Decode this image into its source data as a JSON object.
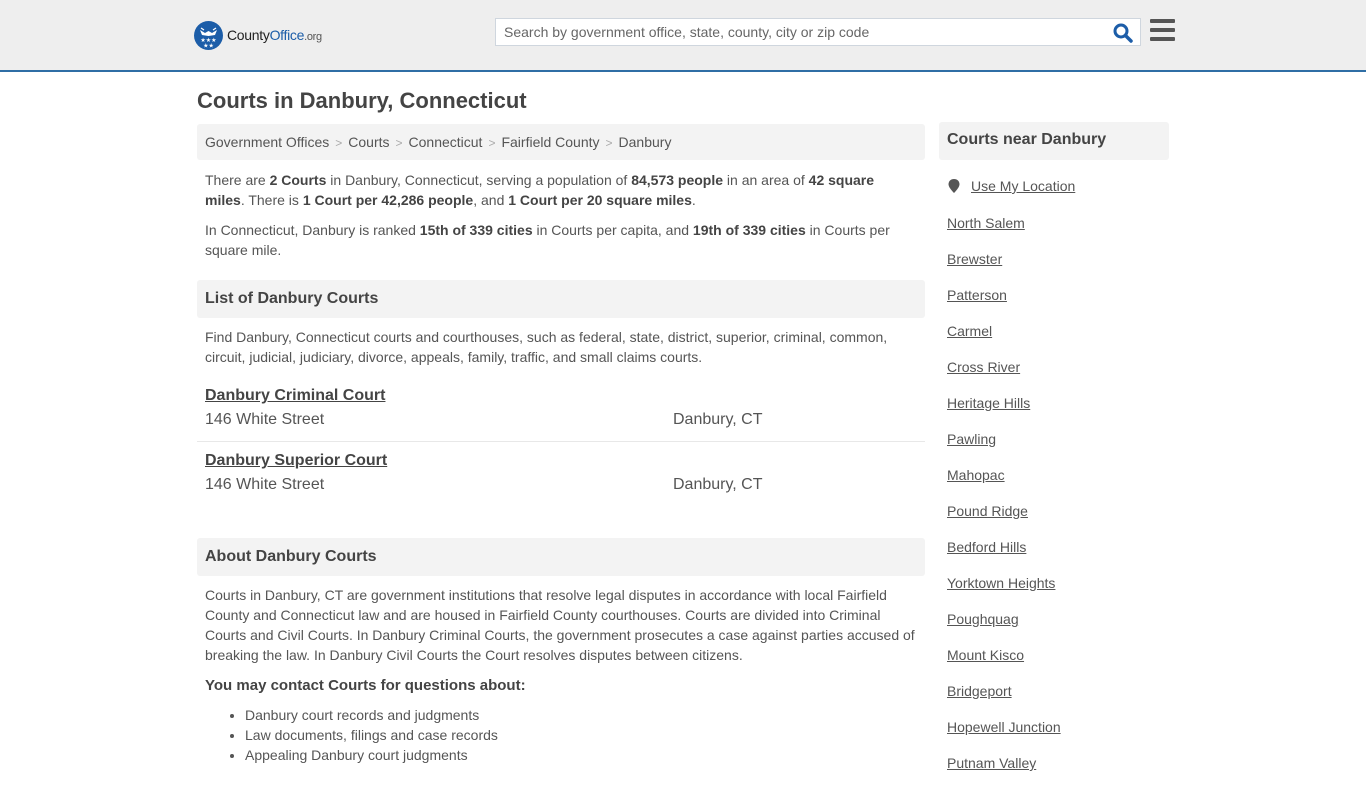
{
  "header": {
    "logo": {
      "name": "County",
      "name_accent": "Office",
      "tld": ".org"
    },
    "search": {
      "placeholder": "Search by government office, state, county, city or zip code",
      "value": ""
    },
    "colors": {
      "accent": "#1c5da8",
      "border": "#2f6ea5",
      "header_bg": "#eeeeee"
    }
  },
  "page": {
    "title": "Courts in Danbury, Connecticut"
  },
  "breadcrumb": [
    "Government Offices",
    "Courts",
    "Connecticut",
    "Fairfield County",
    "Danbury"
  ],
  "summary": {
    "p1": {
      "t1": "There are ",
      "b1": "2 Courts",
      "t2": " in Danbury, Connecticut, serving a population of ",
      "b2": "84,573 people",
      "t3": " in an area of ",
      "b3": "42 square miles",
      "t4": ". There is ",
      "b4": "1 Court per 42,286 people",
      "t5": ", and ",
      "b5": "1 Court per 20 square miles",
      "t6": "."
    },
    "p2": {
      "t1": "In Connecticut, Danbury is ranked ",
      "b1": "15th of 339 cities",
      "t2": " in Courts per capita, and ",
      "b2": "19th of 339 cities",
      "t3": " in Courts per square mile."
    }
  },
  "list_section": {
    "heading": "List of Danbury Courts",
    "intro": "Find Danbury, Connecticut courts and courthouses, such as federal, state, district, superior, criminal, common, circuit, judicial, judiciary, divorce, appeals, family, traffic, and small claims courts.",
    "courts": [
      {
        "name": "Danbury Criminal Court",
        "address": "146 White Street",
        "city": "Danbury, CT"
      },
      {
        "name": "Danbury Superior Court",
        "address": "146 White Street",
        "city": "Danbury, CT"
      }
    ]
  },
  "about_section": {
    "heading": "About Danbury Courts",
    "body": "Courts in Danbury, CT are government institutions that resolve legal disputes in accordance with local Fairfield County and Connecticut law and are housed in Fairfield County courthouses. Courts are divided into Criminal Courts and Civil Courts. In Danbury Criminal Courts, the government prosecutes a case against parties accused of breaking the law. In Danbury Civil Courts the Court resolves disputes between citizens.",
    "contact_heading": "You may contact Courts for questions about:",
    "bullets": [
      "Danbury court records and judgments",
      "Law documents, filings and case records",
      "Appealing Danbury court judgments"
    ]
  },
  "sidebar": {
    "heading": "Courts near Danbury",
    "use_location": "Use My Location",
    "nearby": [
      "North Salem",
      "Brewster",
      "Patterson",
      "Carmel",
      "Cross River",
      "Heritage Hills",
      "Pawling",
      "Mahopac",
      "Pound Ridge",
      "Bedford Hills",
      "Yorktown Heights",
      "Poughquag",
      "Mount Kisco",
      "Bridgeport",
      "Hopewell Junction",
      "Putnam Valley"
    ]
  }
}
